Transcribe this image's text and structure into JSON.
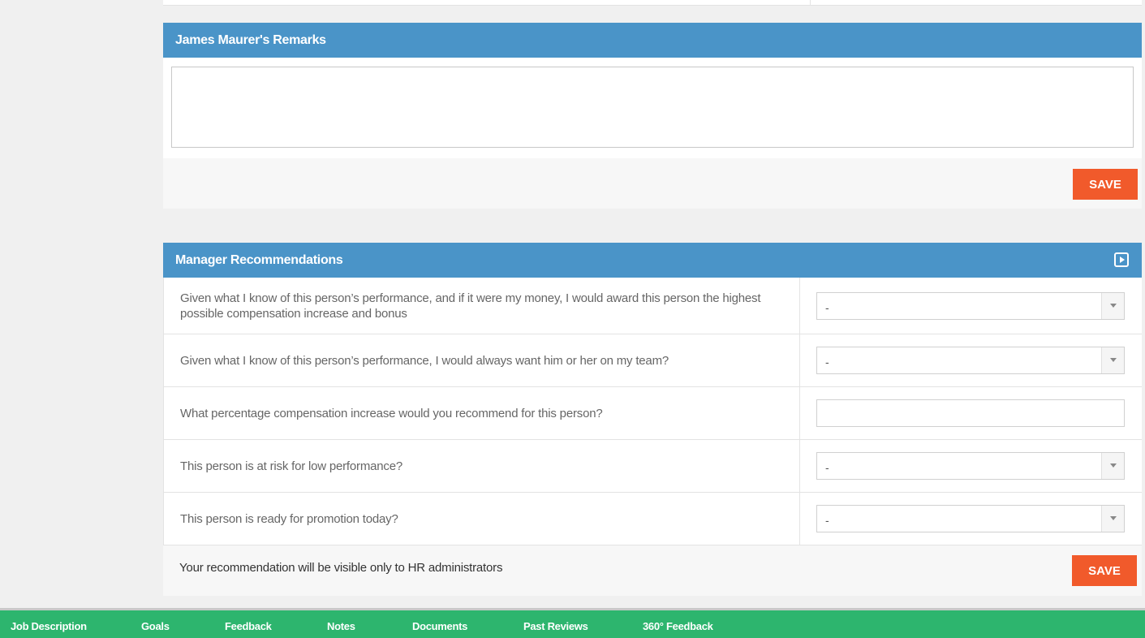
{
  "remarks": {
    "title": "James Maurer's Remarks",
    "text_value": "",
    "save_label": "SAVE"
  },
  "recommendations": {
    "title": "Manager Recommendations",
    "expand_icon": "play-square-icon",
    "rows": [
      {
        "question": "Given what I know of this person’s performance, and if it were my money, I would award this person the highest possible compensation increase and bonus",
        "type": "select",
        "value": "-"
      },
      {
        "question": "Given what I know of this person’s performance, I would always want him or her on my team?",
        "type": "select",
        "value": "-"
      },
      {
        "question": "What percentage compensation increase would you recommend for this person?",
        "type": "text",
        "value": ""
      },
      {
        "question": "This person is at risk for low performance?",
        "type": "select",
        "value": "-"
      },
      {
        "question": "This person is ready for promotion today?",
        "type": "select",
        "value": "-"
      }
    ],
    "note": "Your recommendation will be visible only to HR administrators",
    "save_label": "SAVE"
  },
  "bottom_nav": {
    "items": [
      "Job Description",
      "Goals",
      "Feedback",
      "Notes",
      "Documents",
      "Past Reviews",
      "360° Feedback"
    ]
  },
  "colors": {
    "header_blue": "#4a94c8",
    "save_orange": "#f15a2b",
    "nav_green": "#2db56e"
  }
}
